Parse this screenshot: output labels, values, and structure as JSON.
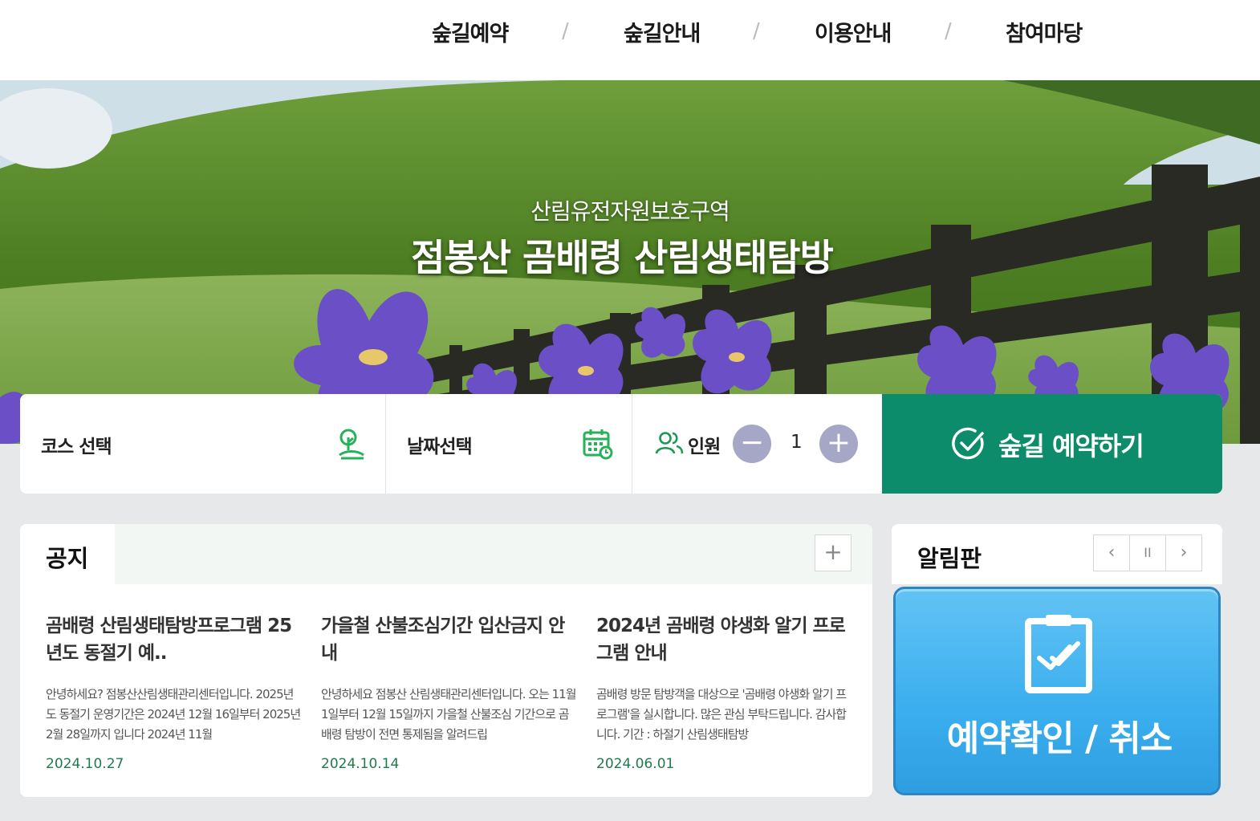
{
  "nav": {
    "items": [
      "숲길예약",
      "숲길안내",
      "이용안내",
      "참여마당"
    ],
    "separator": "/"
  },
  "hero": {
    "subtitle": "산림유전자원보호구역",
    "title": "점봉산 곰배령 산림생태탐방"
  },
  "booking": {
    "course_label": "코스 선택",
    "date_label": "날짜선택",
    "people_label": "인원",
    "count": "1",
    "minus": "−",
    "plus": "+",
    "reserve_label": "숲길 예약하기",
    "accent_color": "#0c8c6a",
    "icon_color": "#27b25a",
    "people_icon_color": "#1d9a52"
  },
  "notice": {
    "title": "공지",
    "more": "+",
    "posts": [
      {
        "title": "곰배령 산림생태탐방프로그램 25년도 동절기 예..",
        "excerpt": "안녕하세요? 점봉산산림생태관리센터입니다. 2025년도 동절기 운영기간은 2024년 12월 16일부터 2025년 2월 28일까지 입니다 2024년 11월",
        "date": "2024.10.27"
      },
      {
        "title": "가을철 산불조심기간 입산금지 안내",
        "excerpt": "안녕하세요 점봉산 산림생태관리센터입니다. 오는 11월 1일부터 12월 15일까지 가을철 산불조심 기간으로 곰배령 탐방이 전면 통제됨을 알려드립",
        "date": "2024.10.14"
      },
      {
        "title": "2024년 곰배령 야생화 알기 프로그램 안내",
        "excerpt": "곰배령 방문 탐방객을 대상으로 '곰배령 야생화 알기 프로그램'을 실시합니다. 많은 관심 부탁드립니다. 감사합니다. 기간 : 하절기 산림생태탐방",
        "date": "2024.06.01"
      }
    ]
  },
  "board": {
    "title": "알림판",
    "prev": "‹",
    "pause": "II",
    "next": "›",
    "card_label": "예약확인 / 취소",
    "card_color": "#3aaeee"
  }
}
